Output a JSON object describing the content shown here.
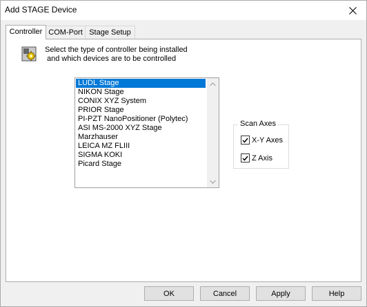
{
  "window": {
    "title": "Add STAGE Device"
  },
  "tabs": [
    {
      "label": "Controller",
      "active": true
    },
    {
      "label": "COM-Port",
      "active": false
    },
    {
      "label": "Stage Setup",
      "active": false
    }
  ],
  "controller": {
    "instruction_line1": "Select the type of controller being installed",
    "instruction_line2": "and which devices are to be controlled",
    "devices": [
      {
        "label": "LUDL Stage",
        "selected": true
      },
      {
        "label": "NIKON Stage",
        "selected": false
      },
      {
        "label": "CONIX XYZ System",
        "selected": false
      },
      {
        "label": "PRIOR Stage",
        "selected": false
      },
      {
        "label": "PI-PZT NanoPositioner (Polytec)",
        "selected": false
      },
      {
        "label": "ASI MS-2000 XYZ Stage",
        "selected": false
      },
      {
        "label": "Marzhauser",
        "selected": false
      },
      {
        "label": "LEICA MZ FLIII",
        "selected": false
      },
      {
        "label": "SIGMA KOKI",
        "selected": false
      },
      {
        "label": "Picard Stage",
        "selected": false
      }
    ],
    "scan_axes": {
      "legend": "Scan Axes",
      "xy_label": "X-Y Axes",
      "xy_checked": true,
      "z_label": "Z Axis",
      "z_checked": true
    }
  },
  "buttons": {
    "ok": "OK",
    "cancel": "Cancel",
    "apply": "Apply",
    "help": "Help"
  },
  "colors": {
    "selection": "#0078d7",
    "panel": "#ffffff",
    "face": "#f0f0f0"
  },
  "icons": [
    "close-icon",
    "wizard-gear-icon",
    "scroll-up-arrow-icon",
    "scroll-down-arrow-icon",
    "checkmark-icon"
  ]
}
